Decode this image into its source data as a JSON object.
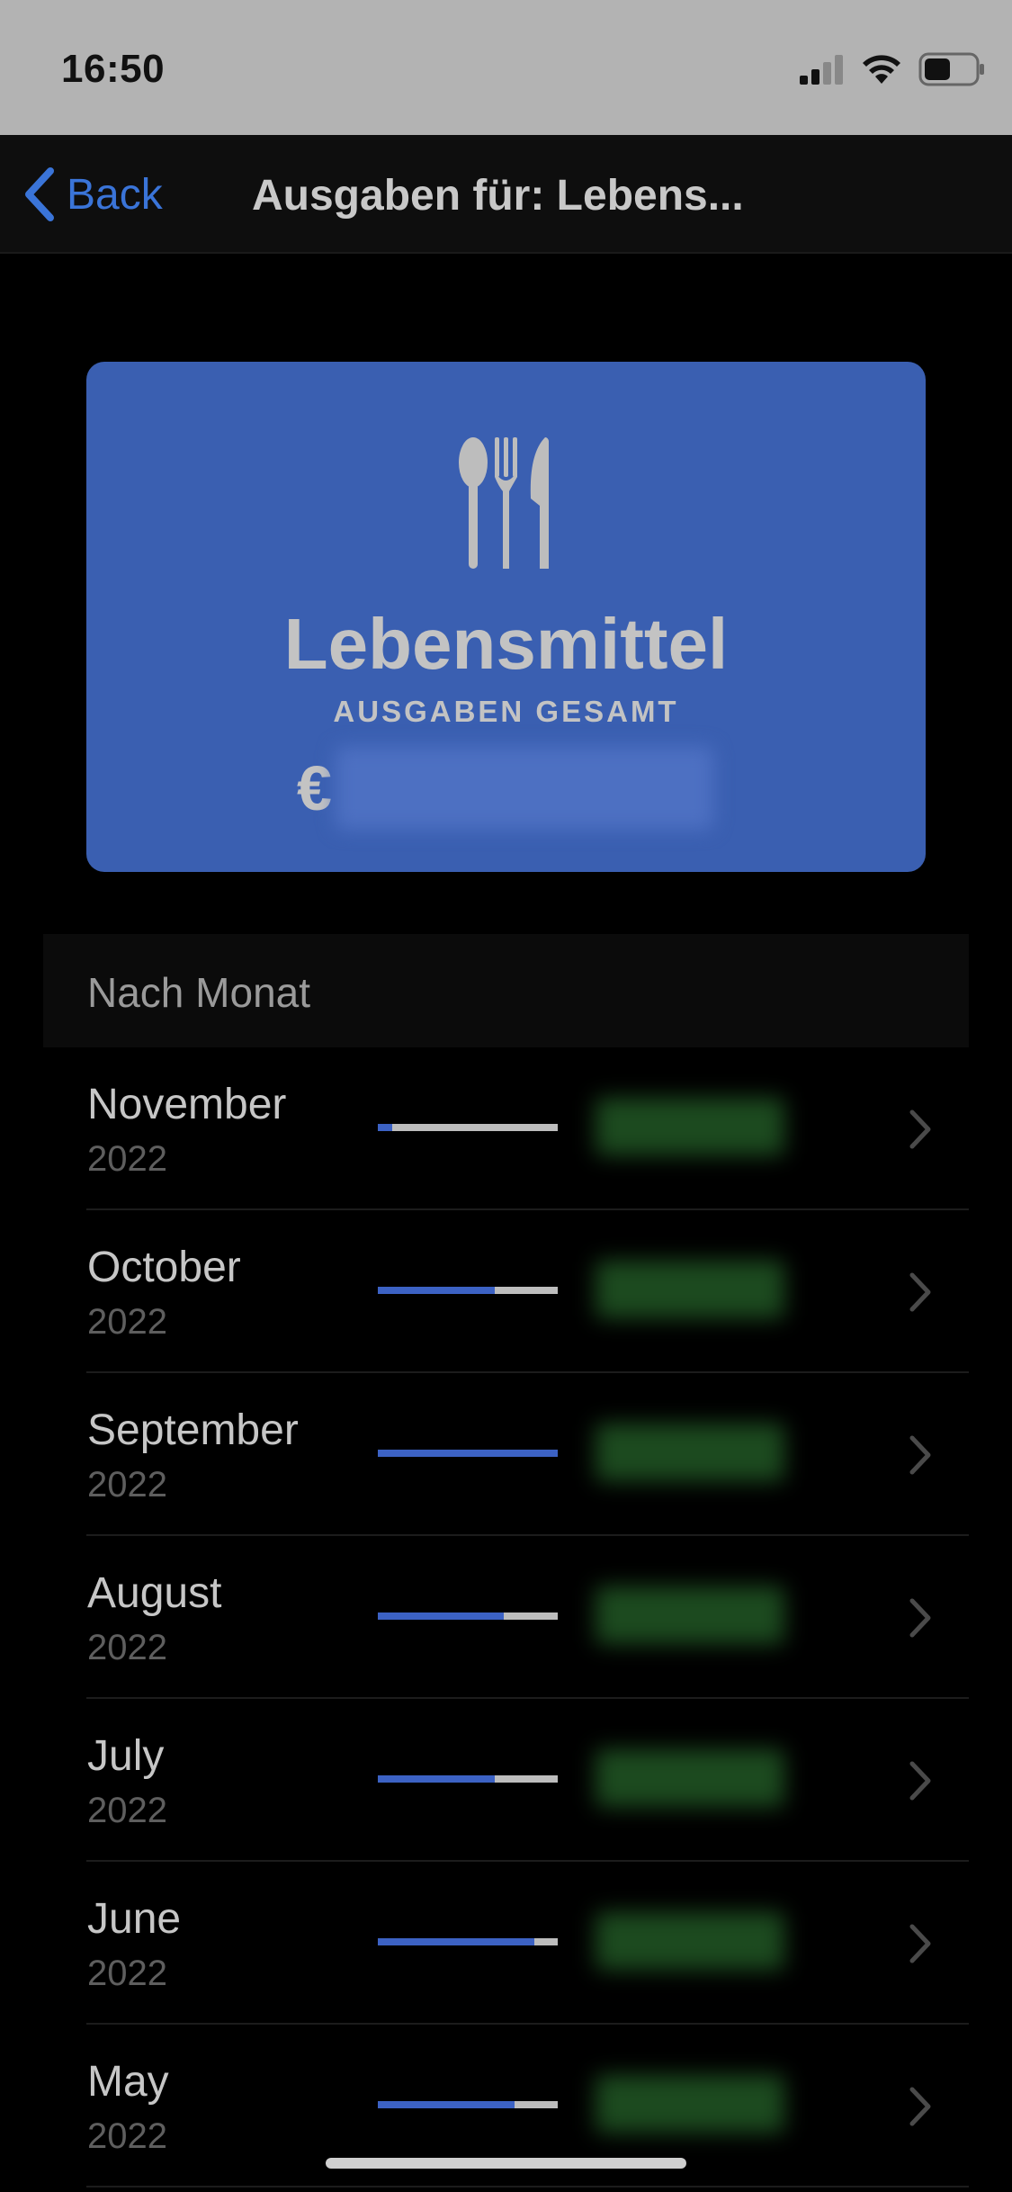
{
  "status_bar": {
    "time": "16:50",
    "signal_icon": "cellular-signal-icon",
    "wifi_icon": "wifi-icon",
    "battery_icon": "battery-icon"
  },
  "nav": {
    "back_label": "Back",
    "back_icon": "chevron-left-icon",
    "title": "Ausgaben für: Lebens..."
  },
  "summary_card": {
    "icon": "cutlery-icon",
    "title": "Lebensmittel",
    "subtitle": "AUSGABEN GESAMT",
    "currency": "€",
    "color": "#3a5fb1"
  },
  "section": {
    "label": "Nach Monat"
  },
  "months": [
    {
      "name": "November",
      "year": "2022",
      "fill": 0.08
    },
    {
      "name": "October",
      "year": "2022",
      "fill": 0.65
    },
    {
      "name": "September",
      "year": "2022",
      "fill": 1.0
    },
    {
      "name": "August",
      "year": "2022",
      "fill": 0.7
    },
    {
      "name": "July",
      "year": "2022",
      "fill": 0.65
    },
    {
      "name": "June",
      "year": "2022",
      "fill": 0.87
    },
    {
      "name": "May",
      "year": "2022",
      "fill": 0.76
    }
  ],
  "colors": {
    "accent": "#3a74d8",
    "bar_fill": "#3c62c4",
    "bar_track": "#bdbdbd"
  }
}
